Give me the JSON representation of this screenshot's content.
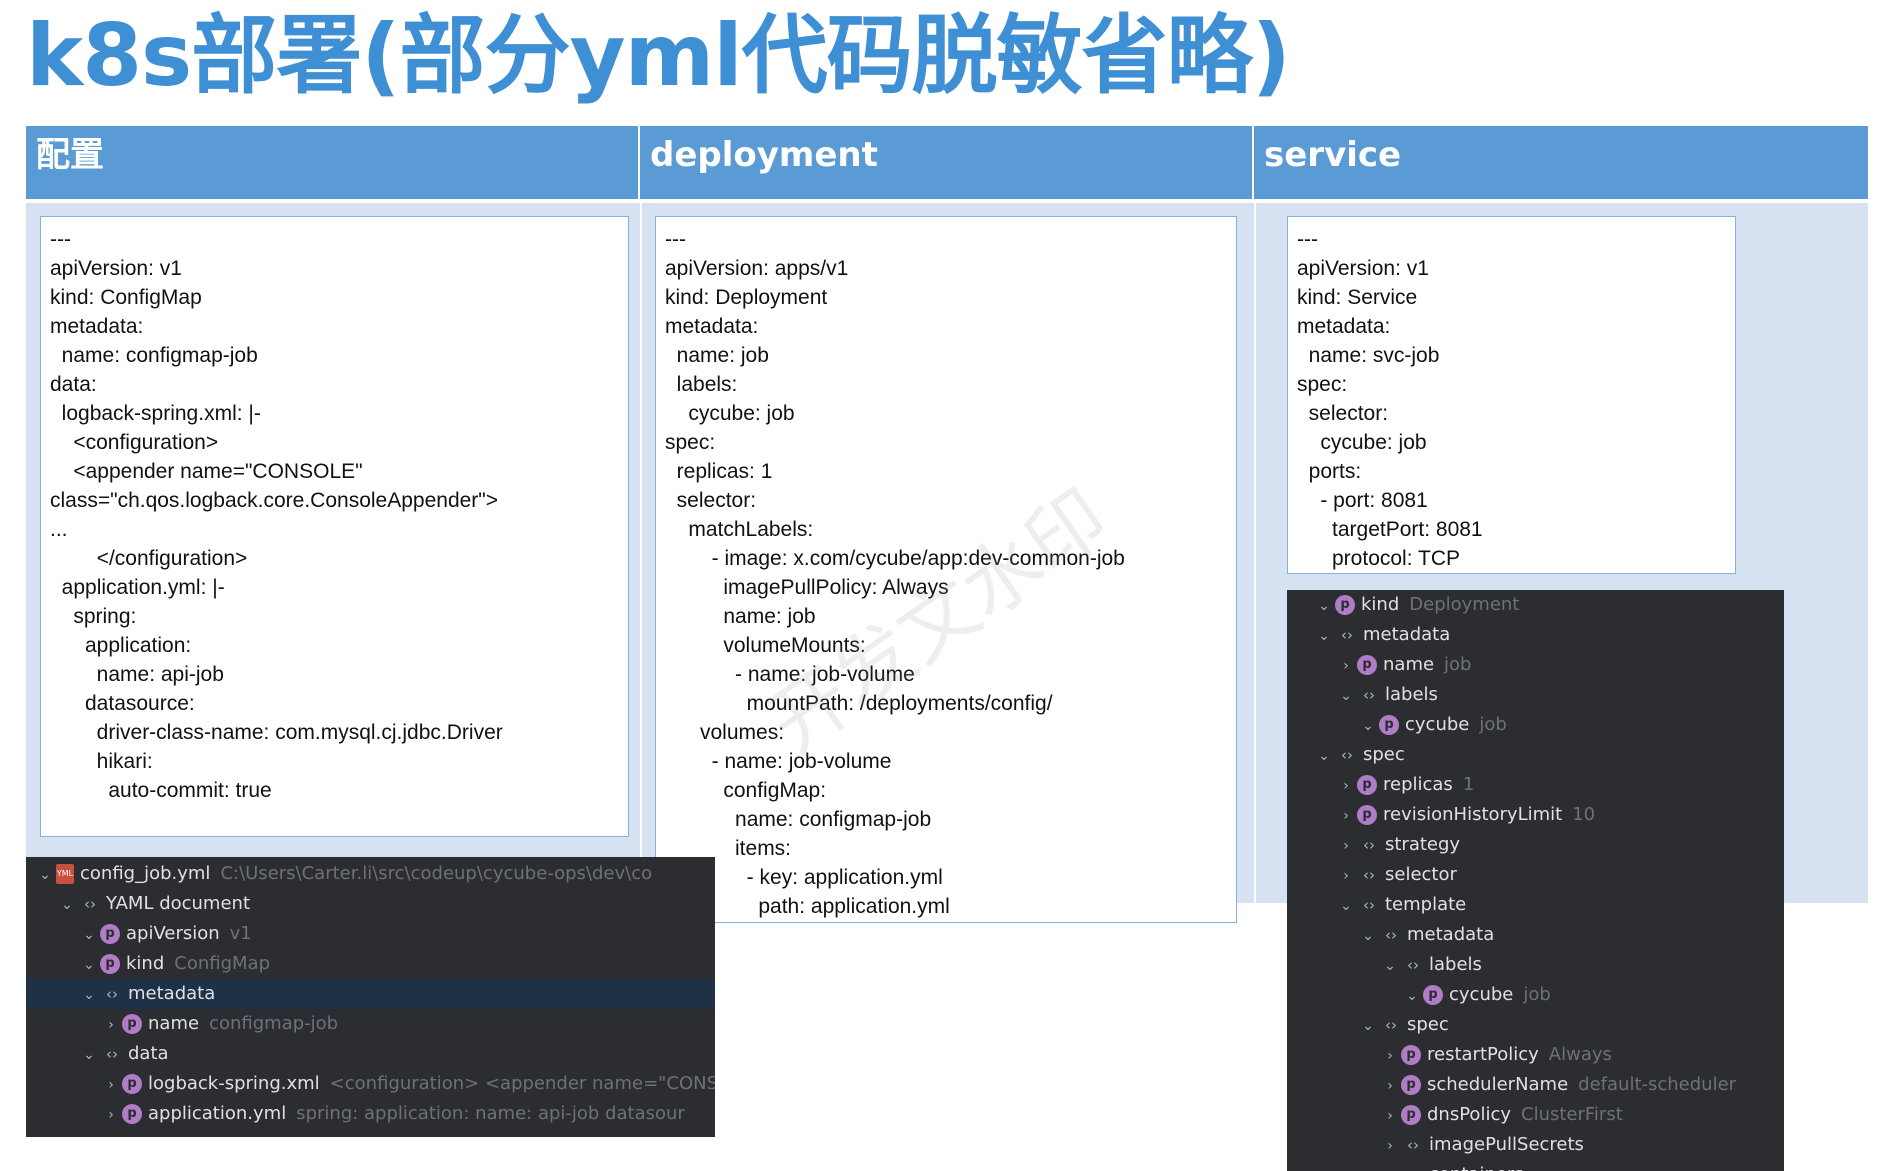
{
  "title": "k8s部署(部分yml代码脱敏省略)",
  "headers": [
    "配置",
    "deployment",
    "service"
  ],
  "watermark": "开发文水印",
  "config_yaml": [
    "---",
    "apiVersion: v1",
    "kind: ConfigMap",
    "metadata:",
    "  name: configmap-job",
    "data:",
    "  logback-spring.xml: |-",
    "    <configuration>",
    "    <appender name=\"CONSOLE\"",
    "class=\"ch.qos.logback.core.ConsoleAppender\">",
    "...",
    "        </configuration>",
    "  application.yml: |-",
    "    spring:",
    "      application:",
    "        name: api-job",
    "      datasource:",
    "        driver-class-name: com.mysql.cj.jdbc.Driver",
    "        hikari:",
    "          auto-commit: true"
  ],
  "deployment_yaml": [
    "---",
    "apiVersion: apps/v1",
    "kind: Deployment",
    "metadata:",
    "  name: job",
    "  labels:",
    "    cycube: job",
    "spec:",
    "  replicas: 1",
    "  selector:",
    "    matchLabels:",
    "        - image: x.com/cycube/app:dev-common-job",
    "          imagePullPolicy: Always",
    "          name: job",
    "          volumeMounts:",
    "            - name: job-volume",
    "              mountPath: /deployments/config/",
    "      volumes:",
    "        - name: job-volume",
    "          configMap:",
    "            name: configmap-job",
    "            items:",
    "              - key: application.yml",
    "                path: application.yml"
  ],
  "service_yaml": [
    "---",
    "apiVersion: v1",
    "kind: Service",
    "metadata:",
    "  name: svc-job",
    "spec:",
    "  selector:",
    "    cycube: job",
    "  ports:",
    "    - port: 8081",
    "      targetPort: 8081",
    "      protocol: TCP"
  ],
  "config_tree": [
    {
      "chev": "⌄",
      "icon": "yml",
      "key": "config_job.yml",
      "val": "C:\\Users\\Carter.li\\src\\codeup\\cycube-ops\\dev\\co",
      "level": 0,
      "sel": false
    },
    {
      "chev": "⌄",
      "icon": "obj",
      "key": "YAML document",
      "val": "",
      "level": 1,
      "sel": false
    },
    {
      "chev": "⌄",
      "icon": "p",
      "key": "apiVersion",
      "val": "v1",
      "level": 2,
      "sel": false
    },
    {
      "chev": "⌄",
      "icon": "p",
      "key": "kind",
      "val": "ConfigMap",
      "level": 2,
      "sel": false
    },
    {
      "chev": "⌄",
      "icon": "obj",
      "key": "metadata",
      "val": "",
      "level": 2,
      "sel": true
    },
    {
      "chev": "›",
      "icon": "p",
      "key": "name",
      "val": "configmap-job",
      "level": 3,
      "sel": false
    },
    {
      "chev": "⌄",
      "icon": "obj",
      "key": "data",
      "val": "",
      "level": 2,
      "sel": false
    },
    {
      "chev": "›",
      "icon": "p",
      "key": "logback-spring.xml",
      "val": "<configuration> <appender name=\"CONS",
      "level": 3,
      "sel": false
    },
    {
      "chev": "›",
      "icon": "p",
      "key": "application.yml",
      "val": "spring:   application:     name: api-job   datasour",
      "level": 3,
      "sel": false
    }
  ],
  "service_tree": [
    {
      "chev": "⌄",
      "icon": "p",
      "key": "kind",
      "val": "Deployment",
      "level": 0
    },
    {
      "chev": "⌄",
      "icon": "obj",
      "key": "metadata",
      "val": "",
      "level": 0
    },
    {
      "chev": "›",
      "icon": "p",
      "key": "name",
      "val": "job",
      "level": 1
    },
    {
      "chev": "⌄",
      "icon": "obj",
      "key": "labels",
      "val": "",
      "level": 1
    },
    {
      "chev": "⌄",
      "icon": "p",
      "key": "cycube",
      "val": "job",
      "level": 2
    },
    {
      "chev": "⌄",
      "icon": "obj",
      "key": "spec",
      "val": "",
      "level": 0
    },
    {
      "chev": "›",
      "icon": "p",
      "key": "replicas",
      "val": "1",
      "level": 1
    },
    {
      "chev": "›",
      "icon": "p",
      "key": "revisionHistoryLimit",
      "val": "10",
      "level": 1
    },
    {
      "chev": "›",
      "icon": "obj",
      "key": "strategy",
      "val": "",
      "level": 1
    },
    {
      "chev": "›",
      "icon": "obj",
      "key": "selector",
      "val": "",
      "level": 1
    },
    {
      "chev": "⌄",
      "icon": "obj",
      "key": "template",
      "val": "",
      "level": 1
    },
    {
      "chev": "⌄",
      "icon": "obj",
      "key": "metadata",
      "val": "",
      "level": 2
    },
    {
      "chev": "⌄",
      "icon": "obj",
      "key": "labels",
      "val": "",
      "level": 3
    },
    {
      "chev": "⌄",
      "icon": "p",
      "key": "cycube",
      "val": "job",
      "level": 4
    },
    {
      "chev": "⌄",
      "icon": "obj",
      "key": "spec",
      "val": "",
      "level": 2
    },
    {
      "chev": "›",
      "icon": "p",
      "key": "restartPolicy",
      "val": "Always",
      "level": 3
    },
    {
      "chev": "›",
      "icon": "p",
      "key": "schedulerName",
      "val": "default-scheduler",
      "level": 3
    },
    {
      "chev": "›",
      "icon": "p",
      "key": "dnsPolicy",
      "val": "ClusterFirst",
      "level": 3
    },
    {
      "chev": "›",
      "icon": "obj",
      "key": "imagePullSecrets",
      "val": "",
      "level": 3
    },
    {
      "chev": "›",
      "icon": "obj",
      "key": "containers",
      "val": "",
      "level": 3
    }
  ]
}
